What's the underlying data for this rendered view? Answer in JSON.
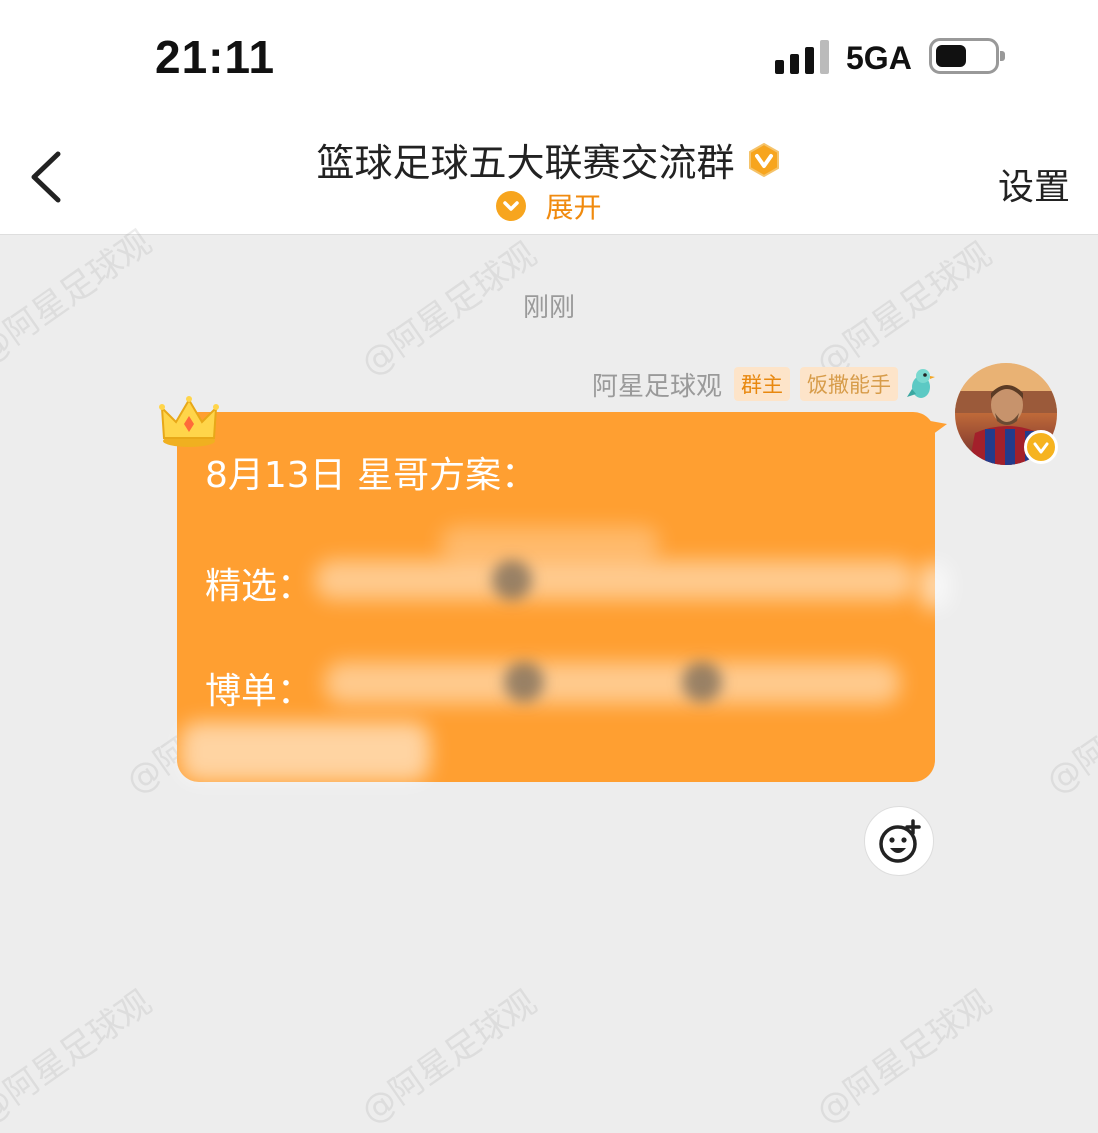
{
  "status_bar": {
    "time": "21:11",
    "network": "5GA"
  },
  "header": {
    "title": "篮球足球五大联赛交流群",
    "expand_label": "展开",
    "settings_label": "设置"
  },
  "chat": {
    "time_divider": "刚刚",
    "sender": {
      "name": "阿星足球观",
      "tag_owner": "群主",
      "tag_title": "饭撒能手"
    },
    "message": {
      "line1": "8月13日  星哥方案：",
      "line2_label": "精选：",
      "line3_label": "博单："
    }
  },
  "watermark": "@阿星足球观",
  "colors": {
    "accent": "#ff9f31",
    "tag_bg": "#fde4c9",
    "tag_text": "#e8880f"
  }
}
